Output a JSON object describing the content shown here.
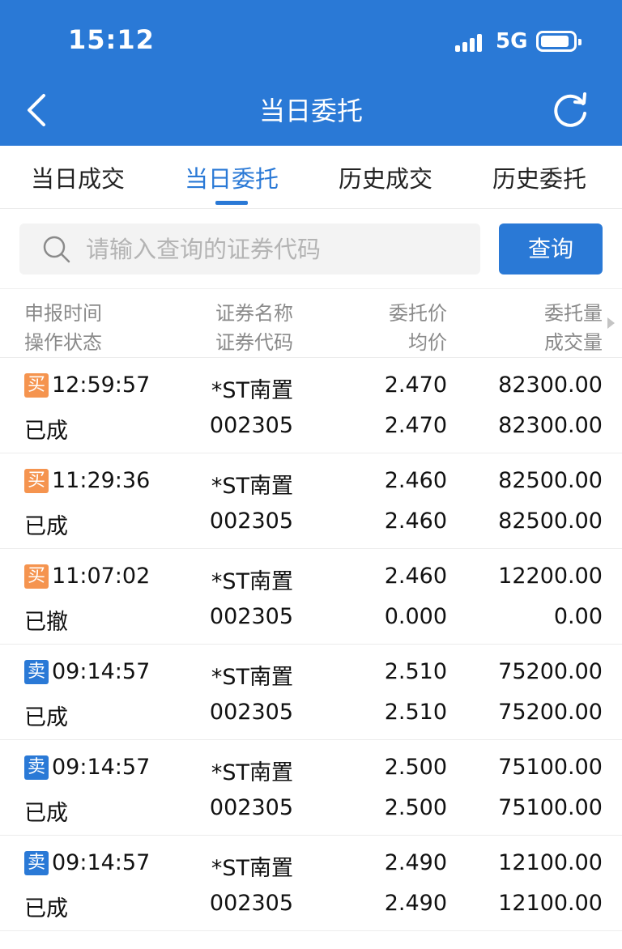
{
  "status_bar": {
    "time": "15:12",
    "network": "5G"
  },
  "header": {
    "title": "当日委托"
  },
  "tabs": [
    {
      "label": "当日成交",
      "active": false
    },
    {
      "label": "当日委托",
      "active": true
    },
    {
      "label": "历史成交",
      "active": false
    },
    {
      "label": "历史委托",
      "active": false
    }
  ],
  "search": {
    "placeholder": "请输入查询的证券代码",
    "value": "",
    "button_label": "查询"
  },
  "columns": {
    "c1": [
      "申报时间",
      "操作状态"
    ],
    "c2": [
      "证券名称",
      "证券代码"
    ],
    "c3": [
      "委托价",
      "均价"
    ],
    "c4": [
      "委托量",
      "成交量"
    ]
  },
  "colors": {
    "primary": "#2a79d6",
    "buy": "#f5944f",
    "sell": "#2a79d6"
  },
  "rows": [
    {
      "side": "买",
      "side_type": "buy",
      "time": "12:59:57",
      "status": "已成",
      "name": "*ST南置",
      "code": "002305",
      "price": "2.470",
      "avg": "2.470",
      "qty": "82300.00",
      "filled": "82300.00"
    },
    {
      "side": "买",
      "side_type": "buy",
      "time": "11:29:36",
      "status": "已成",
      "name": "*ST南置",
      "code": "002305",
      "price": "2.460",
      "avg": "2.460",
      "qty": "82500.00",
      "filled": "82500.00"
    },
    {
      "side": "买",
      "side_type": "buy",
      "time": "11:07:02",
      "status": "已撤",
      "name": "*ST南置",
      "code": "002305",
      "price": "2.460",
      "avg": "0.000",
      "qty": "12200.00",
      "filled": "0.00"
    },
    {
      "side": "卖",
      "side_type": "sell",
      "time": "09:14:57",
      "status": "已成",
      "name": "*ST南置",
      "code": "002305",
      "price": "2.510",
      "avg": "2.510",
      "qty": "75200.00",
      "filled": "75200.00"
    },
    {
      "side": "卖",
      "side_type": "sell",
      "time": "09:14:57",
      "status": "已成",
      "name": "*ST南置",
      "code": "002305",
      "price": "2.500",
      "avg": "2.500",
      "qty": "75100.00",
      "filled": "75100.00"
    },
    {
      "side": "卖",
      "side_type": "sell",
      "time": "09:14:57",
      "status": "已成",
      "name": "*ST南置",
      "code": "002305",
      "price": "2.490",
      "avg": "2.490",
      "qty": "12100.00",
      "filled": "12100.00"
    }
  ]
}
